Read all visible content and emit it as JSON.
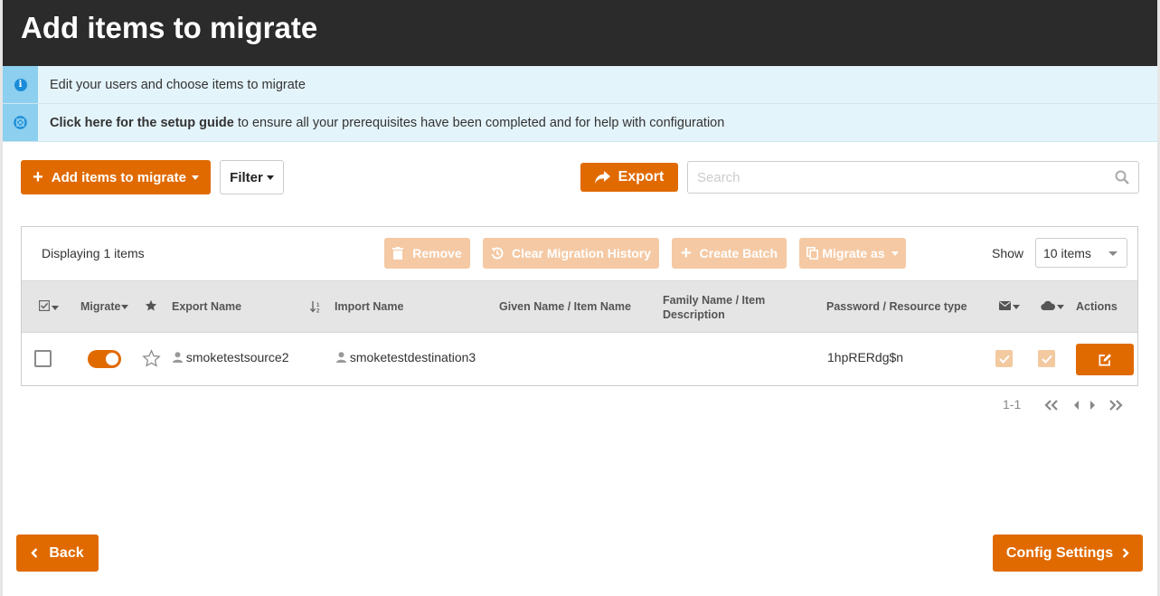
{
  "header": {
    "title": "Add items to migrate"
  },
  "info": {
    "edit_text": "Edit your users and choose items to migrate",
    "guide_bold": "Click here for the setup guide",
    "guide_rest": " to ensure all your prerequisites have been completed and for help with configuration"
  },
  "toolbar": {
    "add_label": "Add items to migrate",
    "filter_label": "Filter",
    "export_label": "Export",
    "search_placeholder": "Search"
  },
  "panel": {
    "displaying": "Displaying 1 items",
    "remove_label": "Remove",
    "clear_label": "Clear Migration History",
    "batch_label": "Create Batch",
    "migrate_as_label": "Migrate as",
    "show_label": "Show",
    "show_value": "10 items"
  },
  "table": {
    "headers": {
      "migrate": "Migrate",
      "export_name": "Export Name",
      "import_name": "Import Name",
      "given_name": "Given Name / Item Name",
      "family_line1": "Family Name / Item",
      "family_line2": "Description",
      "password": "Password / Resource type",
      "actions": "Actions"
    },
    "rows": [
      {
        "export_name": "smoketestsource2",
        "import_name": "smoketestdestination3",
        "given_name": "",
        "family_name": "",
        "password": "1hpRERdg$n",
        "migrate": true
      }
    ]
  },
  "pager": {
    "range": "1-1"
  },
  "footer": {
    "back_label": "Back",
    "config_label": "Config Settings"
  },
  "colors": {
    "accent": "#e06a00",
    "header_bg": "#2b2b2b",
    "info_bg": "#e4f4fb"
  }
}
